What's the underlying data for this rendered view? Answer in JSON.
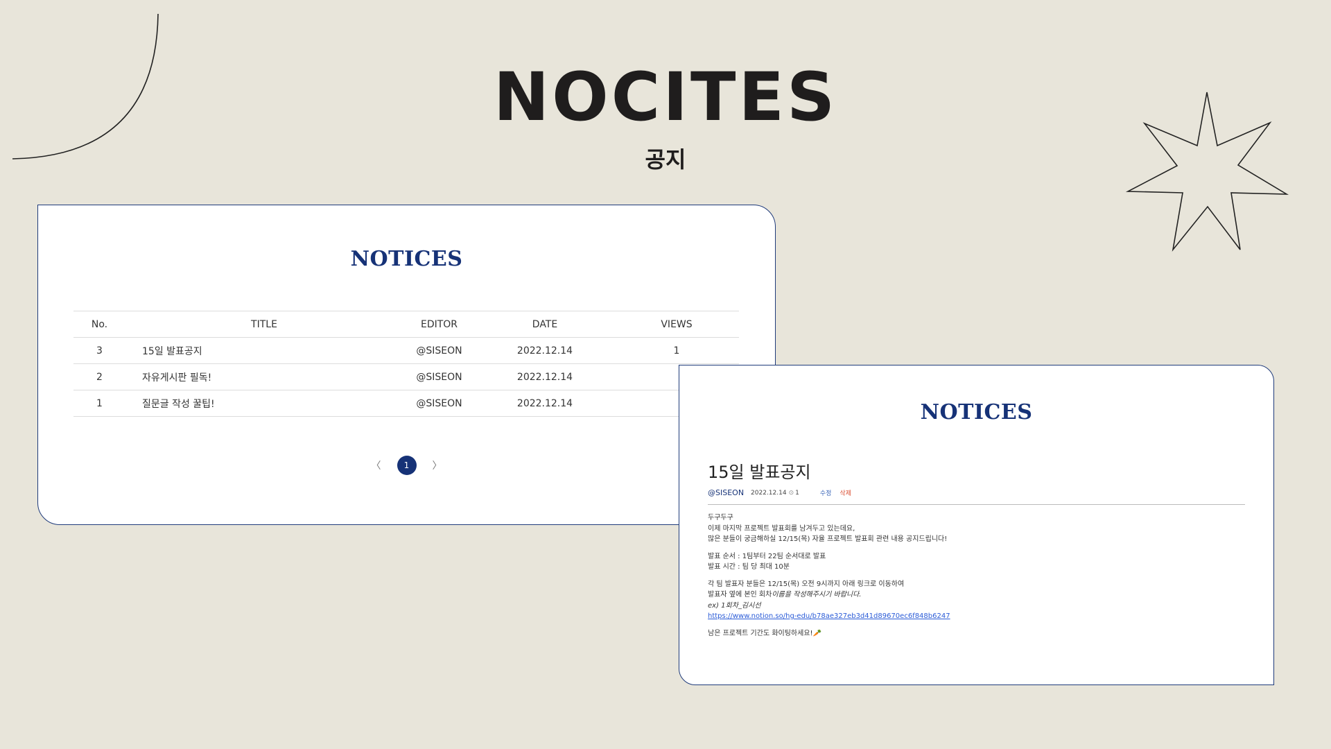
{
  "hero": {
    "title": "NOCITES",
    "subtitle": "공지"
  },
  "list_card": {
    "heading": "NOTICES",
    "columns": [
      "No.",
      "TITLE",
      "EDITOR",
      "DATE",
      "VIEWS"
    ],
    "rows": [
      {
        "no": "3",
        "title": "15일 발표공지",
        "editor": "@SISEON",
        "date": "2022.12.14",
        "views": "1"
      },
      {
        "no": "2",
        "title": "자유게시판 필독!",
        "editor": "@SISEON",
        "date": "2022.12.14",
        "views": ""
      },
      {
        "no": "1",
        "title": "질문글 작성 꿀팁!",
        "editor": "@SISEON",
        "date": "2022.12.14",
        "views": ""
      }
    ],
    "pager": {
      "prev": "〈",
      "current": "1",
      "next": "〉"
    }
  },
  "detail_card": {
    "heading": "NOTICES",
    "title": "15일 발표공지",
    "author": "@SISEON",
    "date": "2022.12.14",
    "views": "1",
    "edit": "수정",
    "delete": "삭제",
    "body": {
      "p1": [
        "두구두구",
        "이제 마지막 프로젝트 발표회를 남겨두고 있는데요,",
        "많은 분들이 궁금해하실 12/15(목) 자율 프로젝트 발표회 관련 내용 공지드립니다!"
      ],
      "p2": [
        "발표 순서 : 1팀부터 22팀 순서대로 발표",
        "발표 시간 : 팀 당 최대 10분"
      ],
      "p3_line1": "각 팀 발표자 분들은 12/15(목) 오전 9시까지 아래 링크로 이동하여",
      "p3_line2a": "발표자 옆에 본인 회차",
      "p3_line2b": "이름을 작성해주시기 바랍니다.",
      "p3_line3": "ex) 1회차_김시선",
      "link": "https://www.notion.so/hg-edu/b78ae327eb3d41d89670ec6f848b6247",
      "p4": "남은 프로젝트 기간도 화이팅하세요!🥕"
    }
  }
}
